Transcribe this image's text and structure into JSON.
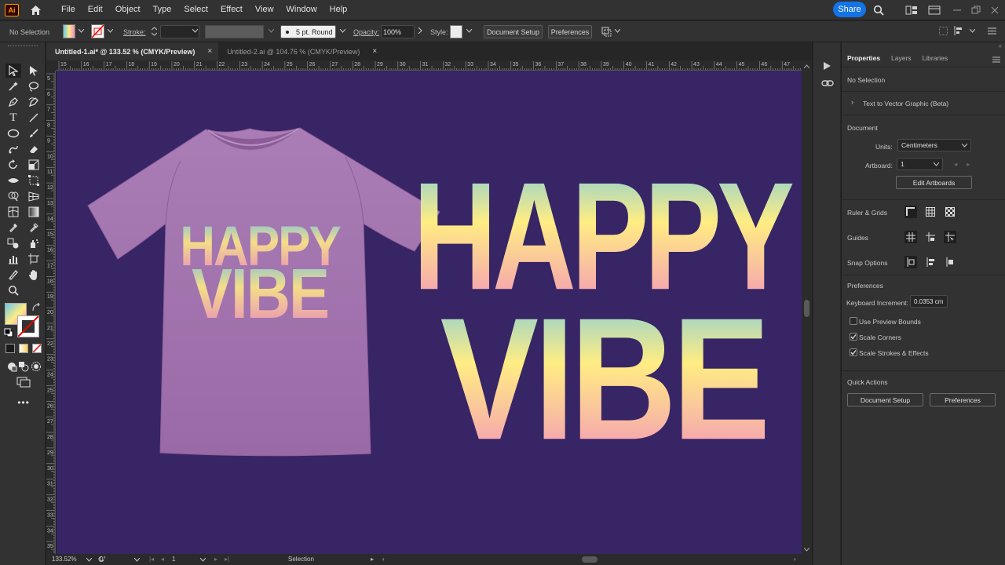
{
  "app": {
    "logo_text": "Ai"
  },
  "menu": [
    "File",
    "Edit",
    "Object",
    "Type",
    "Select",
    "Effect",
    "View",
    "Window",
    "Help"
  ],
  "share_label": "Share",
  "control": {
    "selection_status": "No Selection",
    "stroke_label": "Stroke:",
    "brush_label": "5 pt. Round",
    "opacity_label": "Opacity:",
    "opacity_value": "100%",
    "style_label": "Style:",
    "document_setup": "Document Setup",
    "preferences": "Preferences"
  },
  "tabs": [
    {
      "label": "Untitled-1.ai* @ 133.52 % (CMYK/Preview)",
      "active": true
    },
    {
      "label": "Untitled-2.ai @ 104.76 % (CMYK/Preview)",
      "active": false
    }
  ],
  "tab_close_glyph": "×",
  "ruler_top_labels": [
    "15",
    "16",
    "17",
    "18",
    "19",
    "20",
    "21",
    "22",
    "23",
    "24",
    "25",
    "26",
    "27",
    "28",
    "29",
    "30",
    "31",
    "32",
    "33",
    "34",
    "35",
    "36",
    "37",
    "38",
    "39",
    "40",
    "41",
    "42",
    "43",
    "44",
    "45",
    "46",
    "47"
  ],
  "ruler_left_labels": [
    "5",
    "6",
    "7",
    "8",
    "9",
    "10",
    "11",
    "12",
    "13",
    "14",
    "15",
    "16",
    "17",
    "18",
    "19",
    "20",
    "21",
    "22",
    "23",
    "24",
    "25",
    "26",
    "27",
    "28",
    "29",
    "30",
    "31",
    "32",
    "33",
    "34",
    "35"
  ],
  "artwork": {
    "line1": "HAPPY",
    "line2": "VIBE"
  },
  "colors": {
    "artboard": "#372565",
    "shirt": "#a070ab",
    "grad_top": "#6cc7ea",
    "grad_mid": "#ffed83",
    "grad_bottom": "#f28ac0",
    "accent": "#1473e6"
  },
  "status": {
    "zoom": "133.52%",
    "rotation": "0°",
    "artboard_num": "1",
    "tool": "Selection"
  },
  "panel": {
    "tabs": [
      "Properties",
      "Layers",
      "Libraries"
    ],
    "no_selection": "No Selection",
    "text_to_vector": "Text to Vector Graphic (Beta)",
    "document_header": "Document",
    "units_label": "Units:",
    "units_value": "Centimeters",
    "artboard_label": "Artboard:",
    "artboard_value": "1",
    "edit_artboards": "Edit Artboards",
    "rulers_grids": "Ruler & Grids",
    "guides": "Guides",
    "snap_options": "Snap Options",
    "preferences_header": "Preferences",
    "keyboard_increment_label": "Keyboard Increment:",
    "keyboard_increment_value": "0.0353 cm",
    "use_preview_bounds": "Use Preview Bounds",
    "use_preview_bounds_checked": false,
    "scale_corners": "Scale Corners",
    "scale_corners_checked": true,
    "scale_strokes": "Scale Strokes & Effects",
    "scale_strokes_checked": true,
    "quick_actions": "Quick Actions",
    "qa_document_setup": "Document Setup",
    "qa_preferences": "Preferences"
  }
}
